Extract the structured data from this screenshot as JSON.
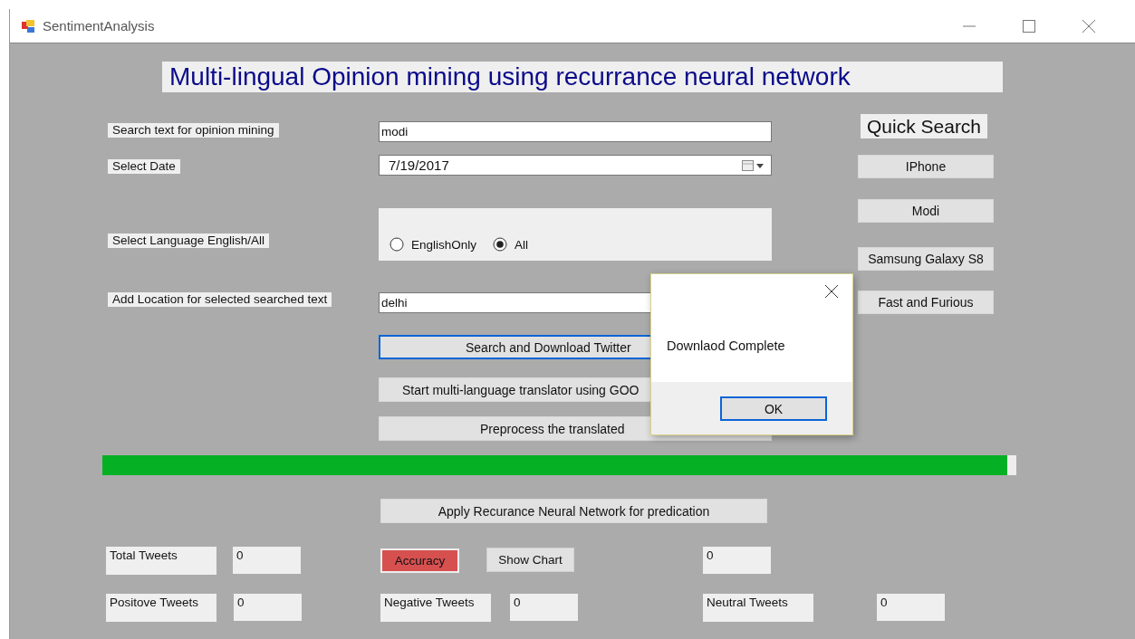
{
  "window": {
    "title": "SentimentAnalysis"
  },
  "heading": "Multi-lingual Opinion mining using recurrance neural network",
  "fields": [
    {
      "kind": "text",
      "label": "Search text for opinion mining",
      "value": "modi"
    },
    {
      "kind": "date",
      "label": "Select Date",
      "value": "7/19/2017"
    },
    {
      "kind": "radio",
      "label": "Select Language English/All",
      "options": [
        {
          "label": "EnglishOnly",
          "selected": false
        },
        {
          "label": "All",
          "selected": true
        }
      ]
    },
    {
      "kind": "text",
      "label": "Add Location for selected searched text",
      "value": "delhi"
    }
  ],
  "action_buttons": [
    {
      "label": "Search and Download Twitter",
      "focused": true
    },
    {
      "label": "Start multi-language translator using GOO",
      "focused": false
    },
    {
      "label": "Preprocess the translated",
      "focused": false
    }
  ],
  "quick_search": {
    "title": "Quick Search",
    "buttons": [
      "IPhone",
      "Modi",
      "Samsung Galaxy S8",
      "Fast and Furious"
    ]
  },
  "progress": {
    "level": 0.99
  },
  "apply_button": "Apply Recurance Neural Network for predication",
  "stats_rows": [
    [
      {
        "kind": "label",
        "text": "Total Tweets"
      },
      {
        "kind": "value",
        "text": "0"
      },
      {
        "kind": "accent-button",
        "text": "Accuracy"
      },
      {
        "kind": "button",
        "text": "Show Chart"
      },
      {
        "kind": "value",
        "text": "0"
      }
    ],
    [
      {
        "kind": "label",
        "text": "Positove Tweets"
      },
      {
        "kind": "value",
        "text": "0"
      },
      {
        "kind": "label",
        "text": "Negative Tweets"
      },
      {
        "kind": "value",
        "text": "0"
      },
      {
        "kind": "label",
        "text": "Neutral Tweets"
      },
      {
        "kind": "value",
        "text": "0"
      }
    ]
  ],
  "dialog": {
    "message": "Downlaod Complete",
    "button": "OK"
  }
}
